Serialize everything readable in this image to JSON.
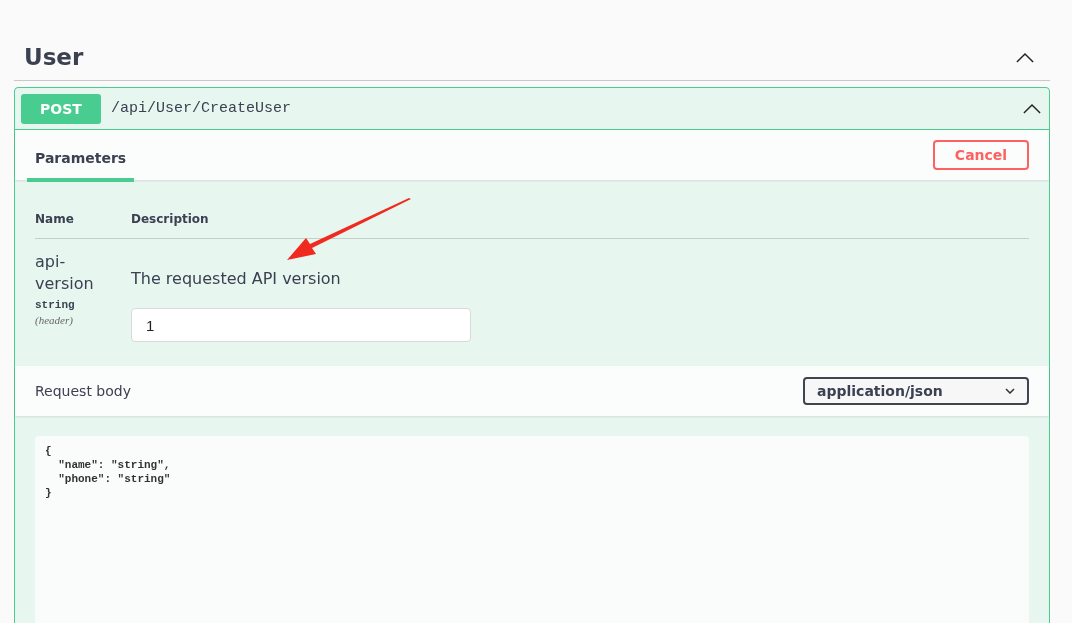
{
  "section": {
    "title": "User",
    "expanded": true
  },
  "operation": {
    "method": "POST",
    "path": "/api/User/CreateUser",
    "expanded": true,
    "tabs": [
      {
        "label": "Parameters",
        "selected": true
      }
    ],
    "cancel_button": "Cancel",
    "parameters": {
      "columns": [
        "Name",
        "Description"
      ],
      "rows": [
        {
          "name": "api-version",
          "type": "string",
          "location": "(header)",
          "description": "The requested API version",
          "value": "1"
        }
      ]
    },
    "request_body": {
      "label": "Request body",
      "content_type": "application/json",
      "example": "{\n  \"name\": \"string\",\n  \"phone\": \"string\"\n}"
    }
  }
}
